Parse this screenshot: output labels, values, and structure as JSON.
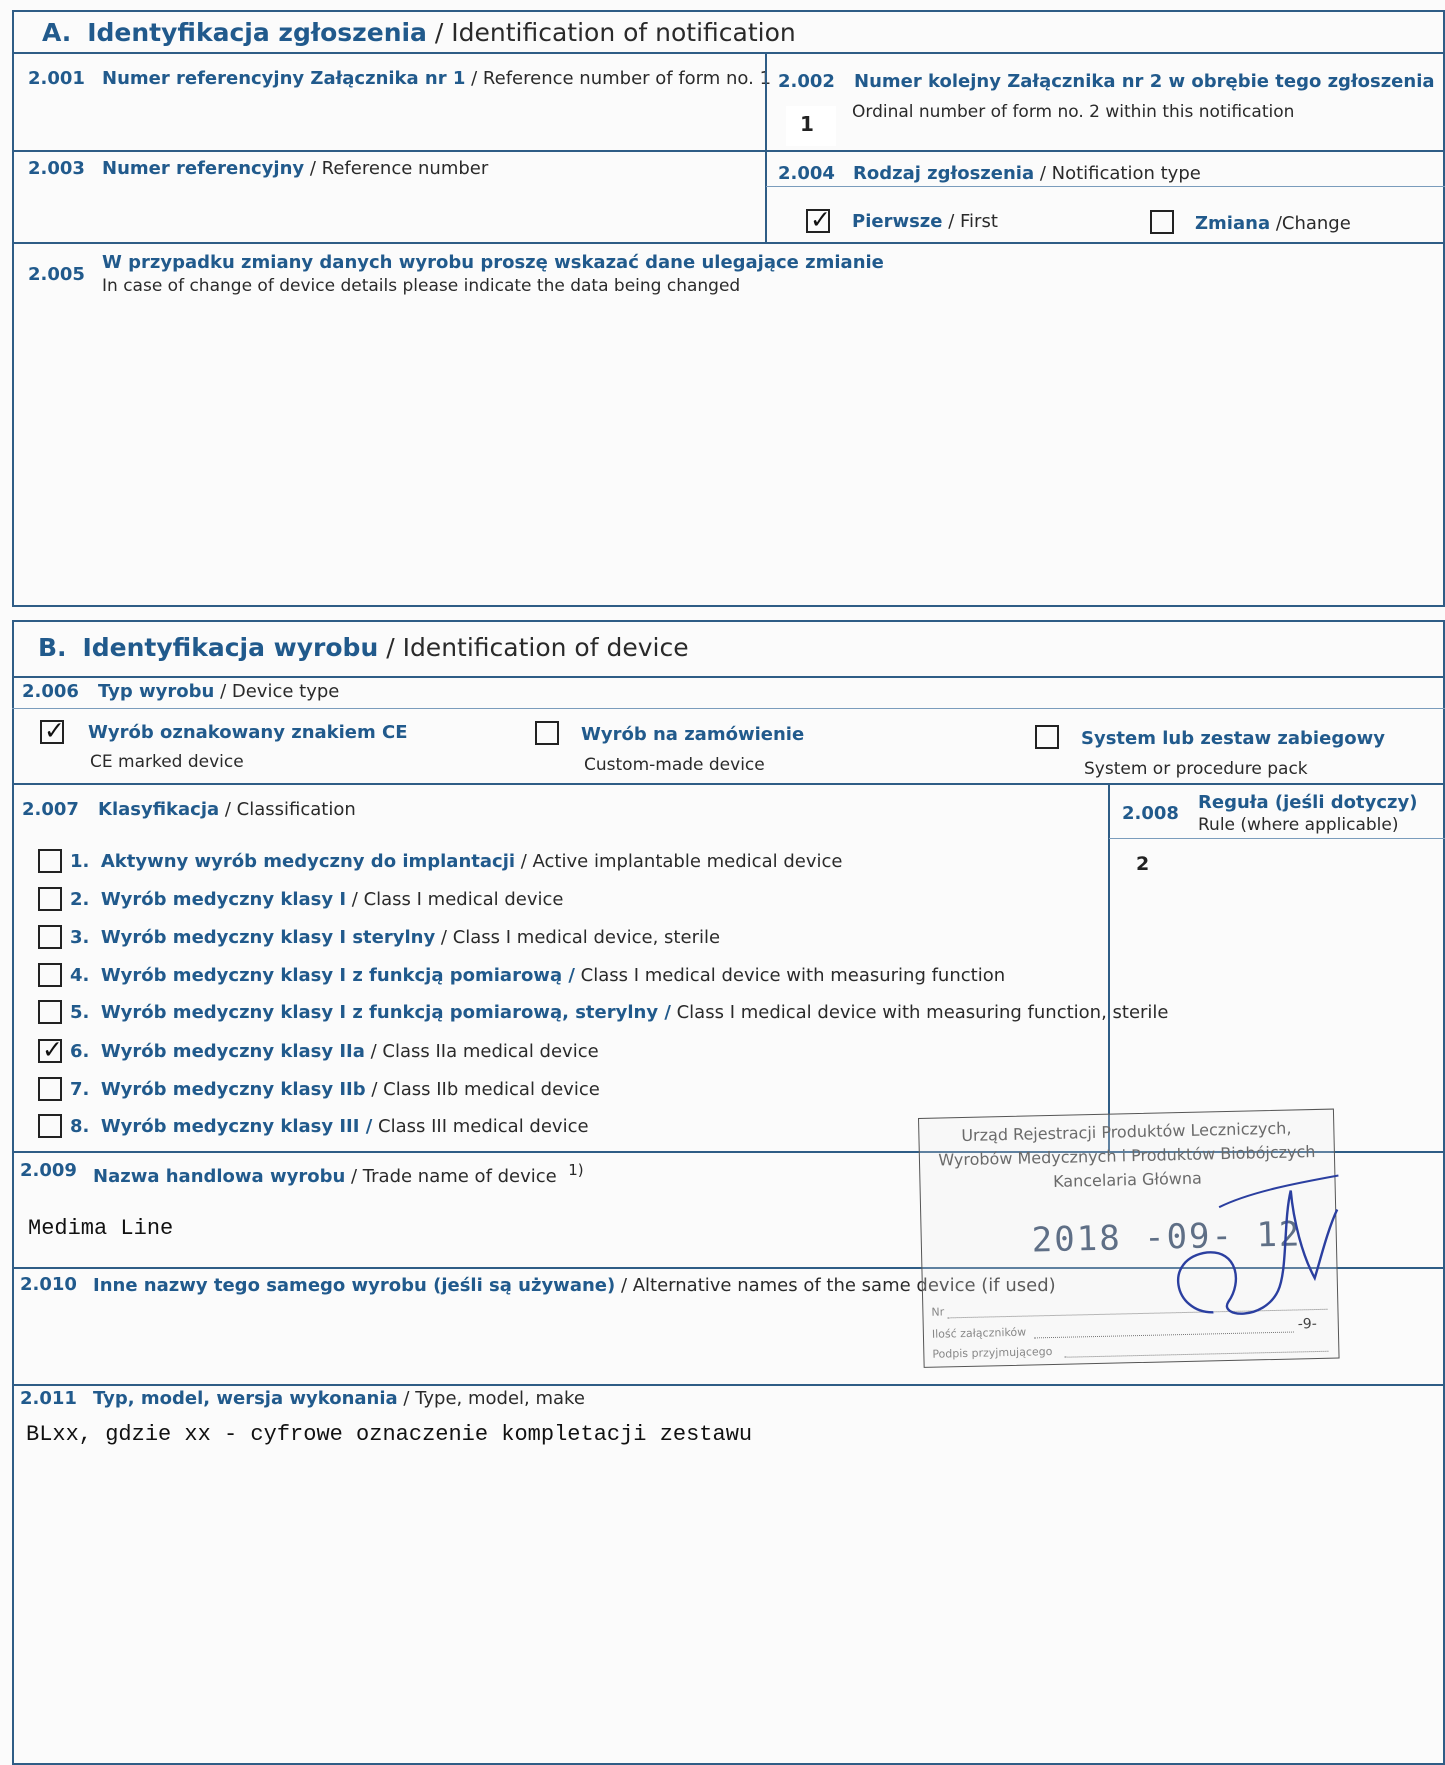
{
  "section_a": {
    "letter": "A.",
    "title_pl": "Identyfikacja zgłoszenia",
    "title_en": " / Identification of notification"
  },
  "fields": {
    "f2001": {
      "num": "2.001",
      "pl": "Numer referencyjny Załącznika nr 1",
      "en": " / Reference number of form no. 1"
    },
    "f2002": {
      "num": "2.002",
      "pl": "Numer kolejny Załącznika nr 2 w obrębie tego zgłoszenia",
      "en": "Ordinal number of form no. 2 within this notification",
      "value": "1"
    },
    "f2003": {
      "num": "2.003",
      "pl": "Numer referencyjny",
      "en": " / Reference number"
    },
    "f2004": {
      "num": "2.004",
      "pl": "Rodzaj zgłoszenia",
      "en": " / Notification type",
      "opt_first_pl": "Pierwsze",
      "opt_first_en": " / First",
      "opt_first_checked": true,
      "opt_change_pl": "Zmiana",
      "opt_change_en": " /Change",
      "opt_change_checked": false
    },
    "f2005": {
      "num": "2.005",
      "pl": "W przypadku zmiany danych wyrobu proszę wskazać dane ulegające zmianie",
      "en": "In case of change of device details please indicate the data being changed"
    }
  },
  "section_b": {
    "letter": "B.",
    "title_pl": "Identyfikacja wyrobu",
    "title_en": " / Identification of device"
  },
  "device_type": {
    "num": "2.006",
    "pl": "Typ wyrobu",
    "en": " / Device type",
    "ce_pl": "Wyrób oznakowany znakiem CE",
    "ce_en": "CE marked device",
    "ce_checked": true,
    "custom_pl": "Wyrób na zamówienie",
    "custom_en": "Custom-made device",
    "custom_checked": false,
    "system_pl": "System lub zestaw zabiegowy",
    "system_en": "System or procedure pack",
    "system_checked": false
  },
  "classification": {
    "num": "2.007",
    "pl": "Klasyfikacja",
    "en": " / Classification",
    "items": [
      {
        "n": "1.",
        "pl": "Aktywny wyrób medyczny do implantacji",
        "en": " / Active implantable medical device",
        "checked": false
      },
      {
        "n": "2.",
        "pl": "Wyrób medyczny klasy I",
        "en": " / Class I medical device",
        "checked": false
      },
      {
        "n": "3.",
        "pl": "Wyrób medyczny klasy I sterylny",
        "en": " / Class I medical device, sterile",
        "checked": false
      },
      {
        "n": "4.",
        "pl": "Wyrób medyczny klasy I z funkcją pomiarową /",
        "en": " Class I medical device with measuring function",
        "checked": false
      },
      {
        "n": "5.",
        "pl": "Wyrób medyczny klasy I z funkcją pomiarową, sterylny /",
        "en": " Class I medical device with measuring function, sterile",
        "checked": false
      },
      {
        "n": "6.",
        "pl": "Wyrób medyczny klasy IIa",
        "en": " / Class IIa medical device",
        "checked": true
      },
      {
        "n": "7.",
        "pl": "Wyrób medyczny klasy IIb",
        "en": " / Class IIb medical device",
        "checked": false
      },
      {
        "n": "8.",
        "pl": "Wyrób medyczny klasy III /",
        "en": " Class III medical device",
        "checked": false
      }
    ]
  },
  "rule": {
    "num": "2.008",
    "pl": "Reguła (jeśli dotyczy)",
    "en": "Rule (where applicable)",
    "value": "2"
  },
  "trade_name": {
    "num": "2.009",
    "pl": "Nazwa handlowa wyrobu",
    "en": " / Trade name of device",
    "sup": "1)",
    "value": "Medima Line"
  },
  "alt_names": {
    "num": "2.010",
    "pl": "Inne nazwy tego samego wyrobu (jeśli są używane)",
    "en": " / Alternative names of the same device (if used)"
  },
  "type_model": {
    "num": "2.011",
    "pl": "Typ, model, wersja wykonania",
    "en": " / Type, model, make",
    "value": "BLxx, gdzie xx - cyfrowe oznaczenie kompletacji zestawu"
  },
  "stamp": {
    "line1": "Urząd Rejestracji Produktów Leczniczych,",
    "line2": "Wyrobów Medycznych i Produktów Biobójczych",
    "line3": "Kancelaria Główna",
    "date": "2018 -09- 12",
    "nr_label": "Nr",
    "att_label": "Ilość załączników",
    "att_value": "-9-",
    "sign_label": "Podpis przyjmującego"
  }
}
